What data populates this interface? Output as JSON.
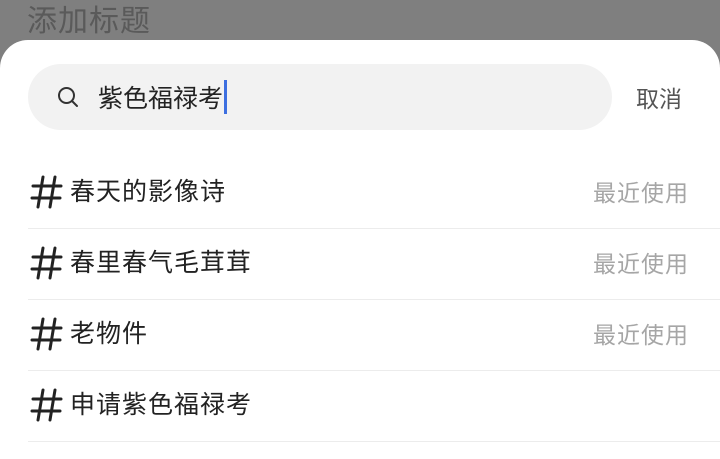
{
  "backdrop": {
    "title": "添加标题"
  },
  "search": {
    "query": "紫色福禄考",
    "cancel_label": "取消"
  },
  "topics": [
    {
      "label": "春天的影像诗",
      "tag": "最近使用"
    },
    {
      "label": "春里春气毛茸茸",
      "tag": "最近使用"
    },
    {
      "label": "老物件",
      "tag": "最近使用"
    },
    {
      "label": "申请紫色福禄考",
      "tag": ""
    }
  ],
  "colors": {
    "overlay": "#7f7f7f",
    "sheet": "#ffffff",
    "search_bg": "#f2f2f2",
    "caret": "#3d6fe0",
    "secondary_text": "#a6a6a6"
  },
  "icons": {
    "search": "search-icon",
    "topic": "hashtag-icon"
  }
}
